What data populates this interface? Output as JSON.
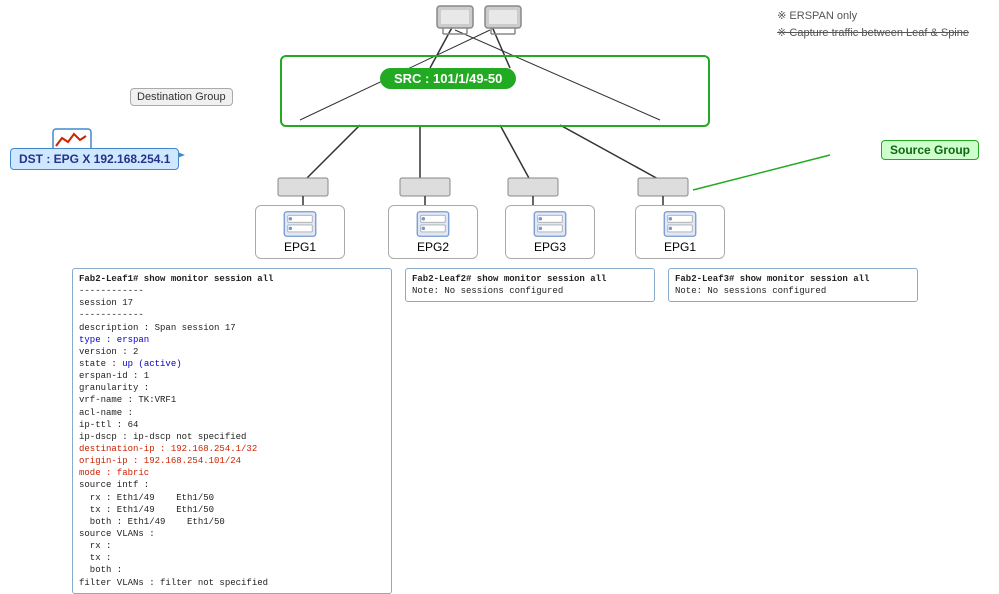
{
  "erspan": {
    "note1": "※ ERSPAN only",
    "note2": "※ Capture traffic between Leaf & Spine"
  },
  "src": {
    "label": "SRC : 101/1/49-50"
  },
  "dest_group": {
    "label": "Destination Group"
  },
  "dst": {
    "label": "DST : EPG X 192.168.254.1"
  },
  "source_group": {
    "label": "Source Group"
  },
  "epgs": [
    {
      "label": "EPG1"
    },
    {
      "label": "EPG2"
    },
    {
      "label": "EPG3"
    },
    {
      "label": "EPG1"
    }
  ],
  "cli_leaf1": {
    "title": "Fab2-Leaf1# show monitor session all",
    "lines": [
      "session 17",
      "------------",
      "description    : Span session 17",
      "type           : erspan",
      "version        : 2",
      "state          : up (active)",
      "erspan-id      : 1",
      "granularity    :",
      "vrf-name       : TK:VRF1",
      "acl-name       :",
      "ip-ttl         : 64",
      "ip-dscp        : ip-dscp not specified",
      "destination-ip : 192.168.254.1/32",
      "origin-ip      : 192.168.254.101/24",
      "mode           : fabric",
      "source intf    :",
      "  rx           : Eth1/49        Eth1/50",
      "  tx           : Eth1/49        Eth1/50",
      "  both         : Eth1/49        Eth1/50",
      "source VLANs   :",
      "  rx           :",
      "  tx           :",
      "  both         :",
      "filter VLANs   : filter not specified"
    ],
    "red_lines": [
      12,
      13,
      14
    ],
    "blue_lines": [
      3
    ]
  },
  "cli_leaf2": {
    "title": "Fab2-Leaf2# show monitor session all",
    "note": "Note: No sessions configured"
  },
  "cli_leaf3": {
    "title": "Fab2-Leaf3# show monitor session all",
    "note": "Note: No sessions configured"
  }
}
